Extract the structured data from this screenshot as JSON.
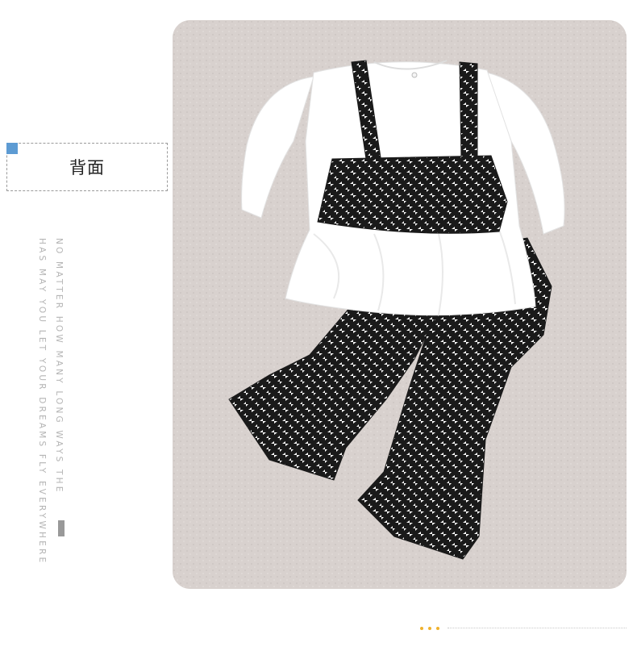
{
  "label": {
    "text": "背面"
  },
  "side_text": {
    "line1": "NO MATTER HOW MANY LONG WAYS THE",
    "line2": "HAS MAY YOU LET YOUR DREAMS FLY EVERYWHERE"
  },
  "colors": {
    "accent": "#5d9bd3",
    "footer_dot": "#f0b22d",
    "background_fabric": "#d8d1ce",
    "garment_white": "#ffffff",
    "garment_check_dark": "#1a1a1a"
  }
}
